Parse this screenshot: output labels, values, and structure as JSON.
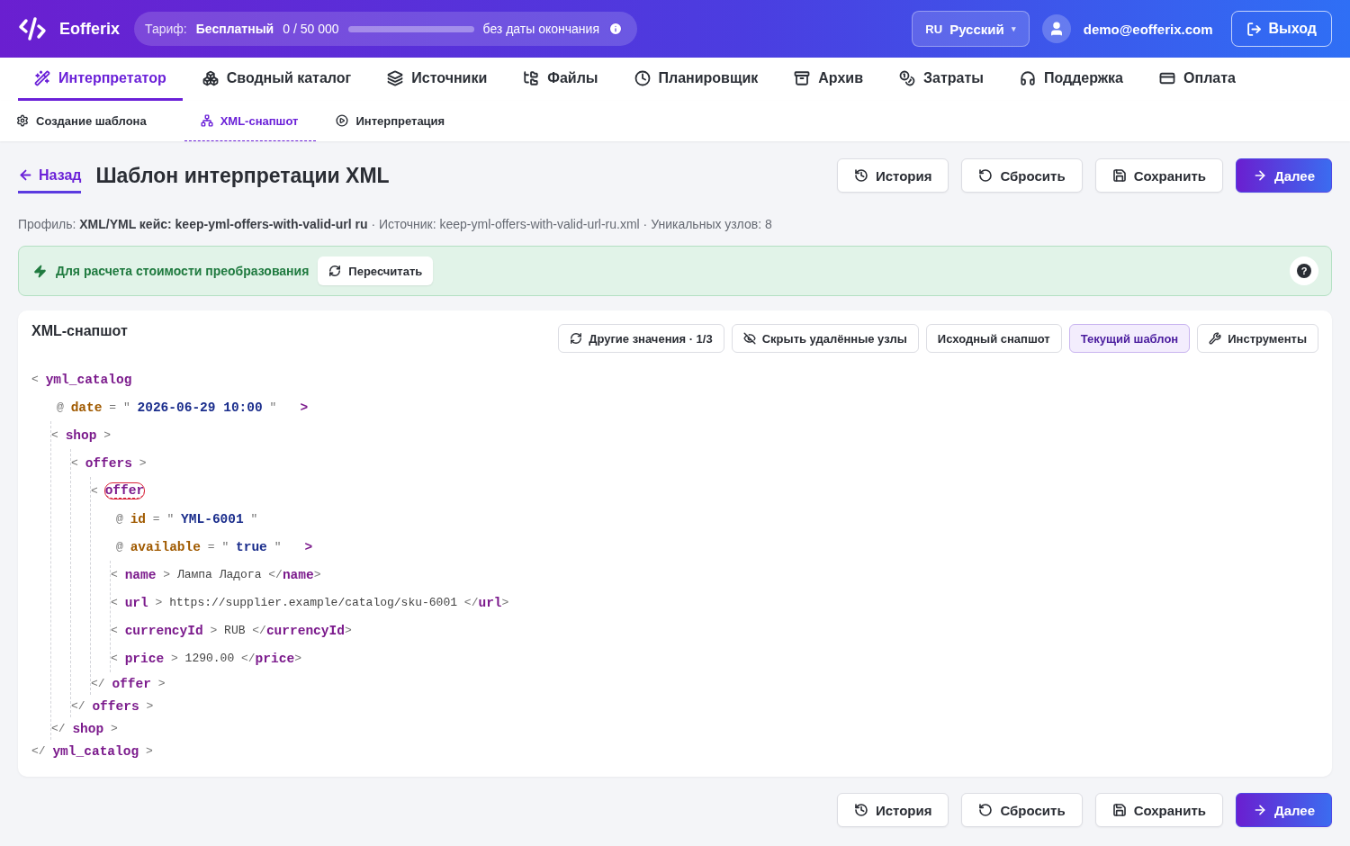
{
  "header": {
    "brand": "Eofferix",
    "plan": {
      "label": "Тариф:",
      "name": "Бесплатный",
      "usage": "0 / 50 000",
      "expiry": "без даты окончания"
    },
    "language": {
      "code": "RU",
      "name": "Русский",
      "caret": "▾"
    },
    "user": {
      "email": "demo@eofferix.com"
    },
    "logout": "Выход"
  },
  "nav": [
    {
      "label": "Интерпретатор",
      "selected": true
    },
    {
      "label": "Сводный каталог",
      "selected": false
    },
    {
      "label": "Источники",
      "selected": false
    },
    {
      "label": "Файлы",
      "selected": false
    },
    {
      "label": "Планировщик",
      "selected": false
    },
    {
      "label": "Архив",
      "selected": false
    },
    {
      "label": "Затраты",
      "selected": false
    },
    {
      "label": "Поддержка",
      "selected": false
    },
    {
      "label": "Оплата",
      "selected": false
    }
  ],
  "subnav": [
    {
      "label": "Создание шаблона",
      "selected": false
    },
    {
      "label": "XML-снапшот",
      "selected": true
    },
    {
      "label": "Интерпретация",
      "selected": false
    }
  ],
  "page": {
    "back": "Назад",
    "title": "Шаблон интерпретации XML",
    "actions": [
      {
        "label": "История",
        "kind": "default"
      },
      {
        "label": "Сбросить",
        "kind": "default"
      },
      {
        "label": "Сохранить",
        "kind": "default"
      },
      {
        "label": "Далее",
        "kind": "primary"
      }
    ],
    "meta": "Профиль: **XML/YML кейс: keep-yml-offers-with-valid-url ru** · Источник: keep-yml-offers-with-valid-url-ru.xml · Уникальных узлов: 8"
  },
  "notice": {
    "text": "Для расчета стоимости преобразования",
    "button": "Пересчитать",
    "help": "?"
  },
  "snapshot": {
    "title": "XML-снапшот",
    "tools": [
      {
        "label": "Другие значения · 1/3",
        "selected": false
      },
      {
        "label": "Скрыть удалённые узлы",
        "selected": false
      },
      {
        "label": "Исходный снапшот",
        "selected": false
      },
      {
        "label": "Текущий шаблон",
        "selected": true
      },
      {
        "label": "Инструменты",
        "selected": false
      }
    ],
    "syntax": {
      "open": "<",
      "close": ">",
      "end_open": "</",
      "at": "@",
      "eq": "=",
      "quote": "\""
    },
    "tree": {
      "tag": "yml_catalog",
      "close_tag": "yml_catalog",
      "flagged": false,
      "attrs": [
        {
          "name": "date",
          "value": "2026-06-29 10:00"
        }
      ],
      "children": [
        {
          "tag": "shop",
          "close_tag": "shop",
          "flagged": false,
          "children": [
            {
              "tag": "offers",
              "close_tag": "offers",
              "flagged": false,
              "children": [
                {
                  "tag": "offer",
                  "close_tag": "offer",
                  "flagged": true,
                  "attrs": [
                    {
                      "name": "id",
                      "value": "YML-6001"
                    },
                    {
                      "name": "available",
                      "value": "true"
                    }
                  ],
                  "children": [
                    {
                      "tag": "name",
                      "text": "Лампа Ладога",
                      "close_tag": "name",
                      "flagged": false
                    },
                    {
                      "tag": "url",
                      "text": "https://supplier.example/catalog/sku-6001",
                      "close_tag": "url",
                      "flagged": false
                    },
                    {
                      "tag": "currencyId",
                      "text": "RUB",
                      "close_tag": "currencyId",
                      "flagged": false
                    },
                    {
                      "tag": "price",
                      "text": "1290.00",
                      "close_tag": "price",
                      "flagged": false
                    }
                  ]
                }
              ]
            }
          ]
        }
      ]
    }
  },
  "footer_actions": [
    {
      "label": "История",
      "kind": "default"
    },
    {
      "label": "Сбросить",
      "kind": "default"
    },
    {
      "label": "Сохранить",
      "kind": "default"
    },
    {
      "label": "Далее",
      "kind": "primary"
    }
  ]
}
